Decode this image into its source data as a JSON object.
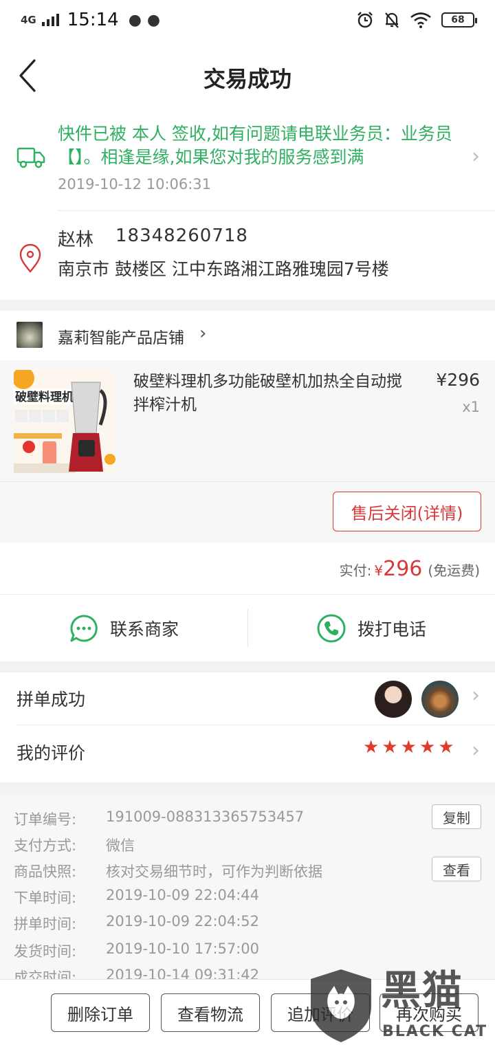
{
  "status_bar": {
    "network": "4G",
    "time": "15:14",
    "battery": "68"
  },
  "header": {
    "title": "交易成功"
  },
  "logistics": {
    "message": "快件已被 本人 签收,如有问题请电联业务员：业务员【】。相逢是缘,如果您对我的服务感到满",
    "time": "2019-10-12 10:06:31"
  },
  "address": {
    "name": "赵林",
    "phone": "18348260718",
    "line": "南京市 鼓楼区 江中东路湘江路雅瑰园7号楼"
  },
  "shop": {
    "name": "嘉莉智能产品店铺"
  },
  "product": {
    "name": "破壁料理机多功能破壁机加热全自动搅拌榨汁机",
    "price": "¥296",
    "quantity": "x1",
    "image_text": "破壁料理机",
    "after_sale_label": "售后关闭(详情)"
  },
  "payment": {
    "label": "实付:",
    "currency": "¥",
    "amount": "296",
    "note": "(免运费)"
  },
  "contact": {
    "merchant_label": "联系商家",
    "phone_label": "拨打电话"
  },
  "group": {
    "label": "拼单成功"
  },
  "review": {
    "label": "我的评价",
    "stars": 5
  },
  "order_info": [
    {
      "key": "订单编号:",
      "value": "191009-088313365753457",
      "button": "复制"
    },
    {
      "key": "支付方式:",
      "value": "微信"
    },
    {
      "key": "商品快照:",
      "value": "核对交易细节时，可作为判断依据",
      "button": "查看"
    },
    {
      "key": "下单时间:",
      "value": "2019-10-09 22:04:44"
    },
    {
      "key": "拼单时间:",
      "value": "2019-10-09 22:04:52"
    },
    {
      "key": "发货时间:",
      "value": "2019-10-10 17:57:00"
    },
    {
      "key": "成交时间:",
      "value": "2019-10-14 09:31:42"
    }
  ],
  "bottom_bar": {
    "delete_label": "删除订单",
    "logistics_label": "查看物流",
    "add_review_label": "追加评价",
    "rebuy_label": "再次购买"
  },
  "watermark": {
    "cn": "黑猫",
    "en": "BLACK CAT"
  },
  "colors": {
    "accent_red": "#d9383a",
    "logistics_green": "#2fb060",
    "star_red": "#e23b2e"
  }
}
